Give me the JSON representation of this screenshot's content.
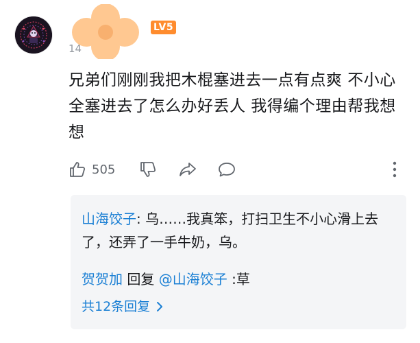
{
  "comment": {
    "level": "LV5",
    "date": "14",
    "text": "兄弟们刚刚我把木棍塞进去一点有点爽 不小心全塞进去了怎么办好丢人 我得编个理由帮我想想",
    "like_count": "505",
    "icons": {
      "like": "thumbs-up-icon",
      "dislike": "thumbs-down-icon",
      "share": "share-icon",
      "reply": "reply-icon",
      "more": "more-vertical-icon"
    }
  },
  "replies": {
    "items": [
      {
        "author": "山海饺子",
        "separator": ": ",
        "text": "乌……我真笨，打扫卫生不小心滑上去了，还弄了一手牛奶，乌。"
      },
      {
        "author": "贺贺加",
        "middle": " 回复 ",
        "mention": "@山海饺子",
        "separator": " :",
        "text": "草"
      }
    ],
    "total_label": "共12条回复",
    "total_icon": "chevron-right-icon"
  },
  "colors": {
    "link": "#1a7fd4",
    "level_badge": "#ff8c2e",
    "mask": "#ffc891",
    "reply_bg": "#f4f5f7",
    "muted": "#61666d"
  }
}
